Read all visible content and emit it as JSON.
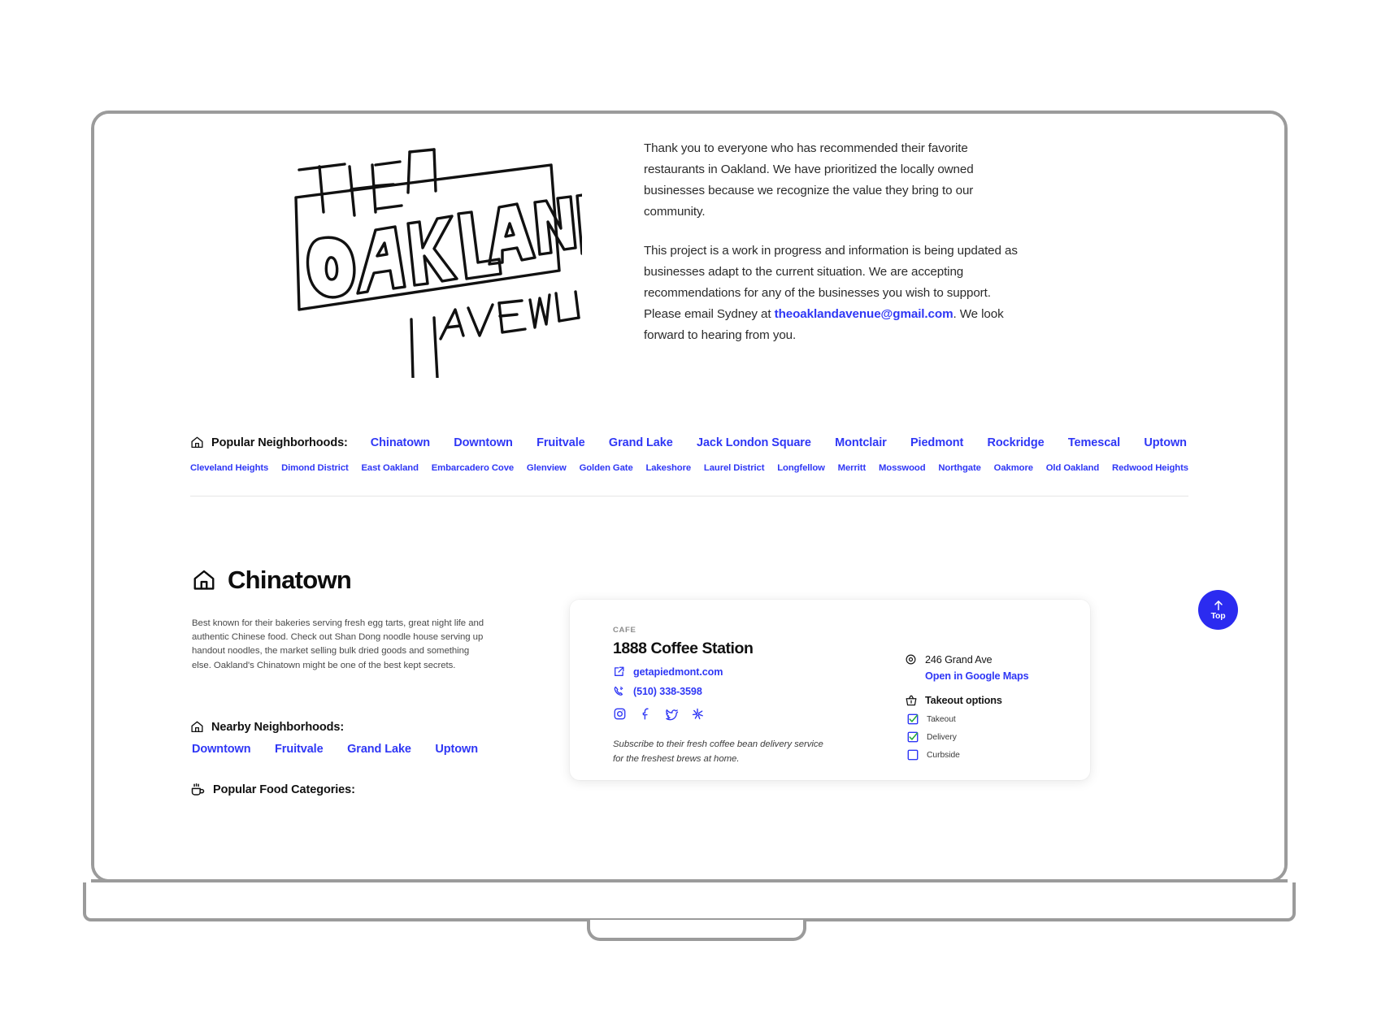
{
  "intro": {
    "paragraph_1": "Thank you to everyone who has recommended their favorite restaurants in Oakland. We have prioritized the locally owned businesses because we recognize the value they bring to our community.",
    "paragraph_2_before": "This project is a work in progress and information is being updated as businesses adapt  to the current situation.  We are accepting recommendations for any of the businesses you wish to support. Please email Sydney at ",
    "email_link": "theoaklandavenue@gmail.com",
    "paragraph_2_after": ". We look forward to hearing from you."
  },
  "logo": {
    "line_top": "THE",
    "line_main": "OAKLAND",
    "line_bottom": "AVENUE"
  },
  "neighborhoods_strip": {
    "label": "Popular Neighborhoods:",
    "icon": "home-icon",
    "primary": [
      "Chinatown",
      "Downtown",
      "Fruitvale",
      "Grand Lake",
      "Jack London Square",
      "Montclair",
      "Piedmont",
      "Rockridge",
      "Temescal",
      "Uptown"
    ],
    "secondary": [
      "Cleveland Heights",
      "Dimond District",
      "East Oakland",
      "Embarcadero Cove",
      "Glenview",
      "Golden Gate",
      "Lakeshore",
      "Laurel District",
      "Longfellow",
      "Merritt",
      "Mosswood",
      "Northgate",
      "Oakmore",
      "Old Oakland",
      "Redwood Heights"
    ]
  },
  "section": {
    "title": "Chinatown",
    "icon": "home-icon",
    "description": "Best known for their bakeries serving fresh egg tarts, great night life and authentic Chinese food. Check out Shan Dong noodle house serving up handout noodles, the market selling bulk dried goods and something else. Oakland's Chinatown might be one of the best kept secrets.",
    "nearby_label": "Nearby Neighborhoods:",
    "nearby": [
      "Downtown",
      "Fruitvale",
      "Grand Lake",
      "Uptown"
    ],
    "food_label": "Popular Food Categories:",
    "food_icon": "coffee-cup-icon"
  },
  "business_card": {
    "category": "CAFE",
    "name": "1888 Coffee Station",
    "website": "getapiedmont.com",
    "phone": "(510) 338-3598",
    "socials": [
      "instagram-icon",
      "facebook-icon",
      "twitter-icon",
      "yelp-icon"
    ],
    "note": "Subscribe to their fresh coffee bean delivery service for the freshest brews at home.",
    "address": "246 Grand Ave",
    "maps_link": "Open in Google Maps",
    "takeout_title": "Takeout options",
    "options": [
      {
        "label": "Takeout",
        "checked": true
      },
      {
        "label": "Delivery",
        "checked": true
      },
      {
        "label": "Curbside",
        "checked": false
      }
    ]
  },
  "top_button": {
    "label": "Top",
    "icon": "arrow-up-icon"
  },
  "colors": {
    "link_blue": "#2f37f5",
    "button_blue": "#2b2bf0",
    "check_green": "#23aa3a",
    "frame_gray": "#9b9b9b"
  }
}
